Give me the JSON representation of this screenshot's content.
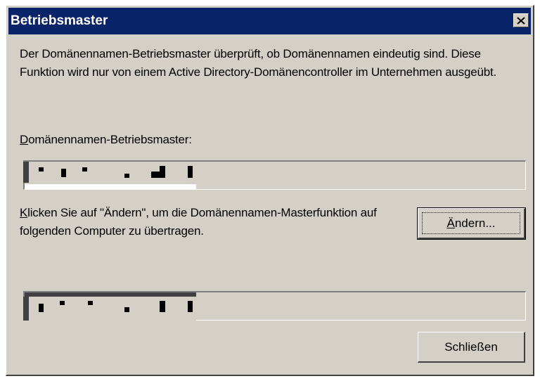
{
  "window": {
    "title": "Betriebsmaster",
    "close_glyph": "×"
  },
  "description": "Der Domänennamen-Betriebsmaster überprüft, ob Domänennamen eindeutig sind. Diese Funktion wird nur von einem Active Directory-Domänencontroller im Unternehmen ausgeübt.",
  "operations_master": {
    "label_mnemonic": "D",
    "label_rest": "omänennamen-Betriebsmaster:"
  },
  "change_section": {
    "text_mnemonic": "K",
    "text_rest": "licken Sie auf \"Ändern\", um die Domänennamen-Masterfunktion auf folgenden Computer zu übertragen."
  },
  "buttons": {
    "change_mnemonic": "Ä",
    "change_rest": "ndern...",
    "close": "Schließen"
  },
  "icons": {
    "close": "close-x-icon",
    "redaction": "redacted-text-block"
  }
}
